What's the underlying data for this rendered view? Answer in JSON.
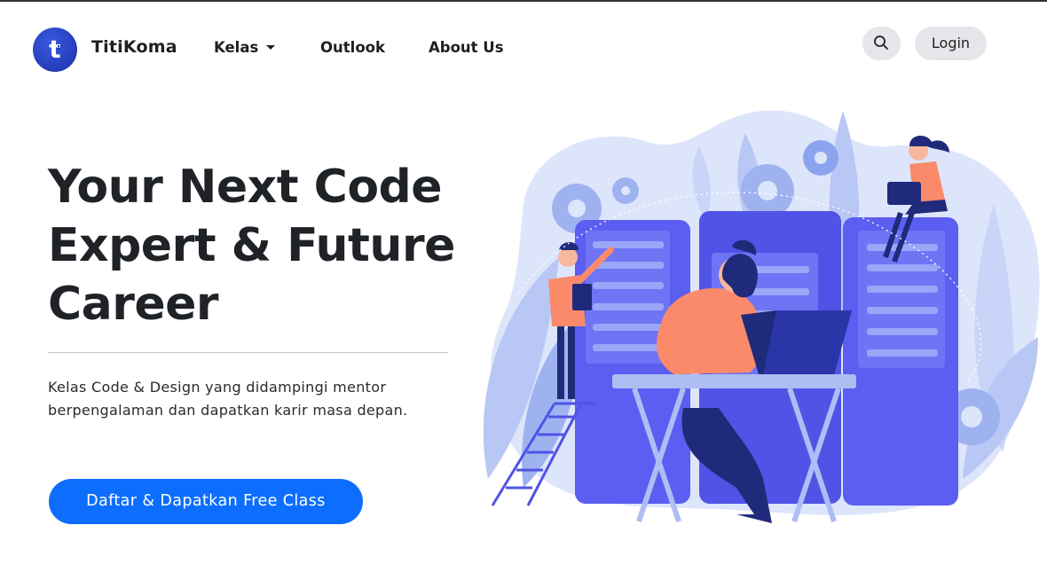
{
  "nav": {
    "brand": "TitiKoma",
    "logo_letter": "t",
    "links": [
      {
        "label": "Kelas",
        "has_dropdown": true
      },
      {
        "label": "Outlook"
      },
      {
        "label": "About Us"
      }
    ],
    "search_icon": "search-icon",
    "login_label": "Login"
  },
  "hero": {
    "title_lines": [
      "Your Next Code",
      "Expert & Future",
      "Career"
    ],
    "subtitle": "Kelas Code & Design yang didampingi mentor berpengalaman dan dapatkan karir masa depan.",
    "cta_label": "Daftar & Dapatkan Free Class",
    "illustration": "developers-server-room-illustration"
  },
  "colors": {
    "primary": "#0d6efd",
    "logo": "#2640c4",
    "pill_bg": "#e4e6e9",
    "illustration_blue": "#5b5ef0",
    "illustration_light": "#d8e2fb",
    "illustration_orange": "#fb8a6a"
  }
}
